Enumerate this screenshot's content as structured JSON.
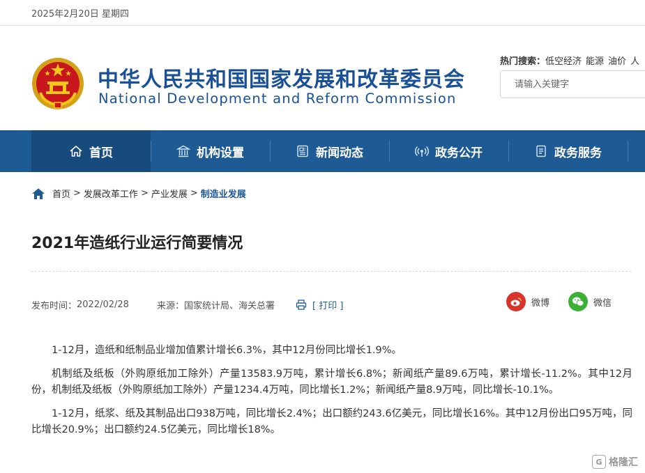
{
  "topbar": {
    "date": "2025年2月20日 星期四"
  },
  "header": {
    "site_name_cn": "中华人民共和国国家发展和改革委员会",
    "site_name_en": "National Development and Reform Commission",
    "hot_search_label": "热门搜索：",
    "hot_keywords": [
      "低空经济",
      "能源",
      "油价",
      "人"
    ],
    "search_placeholder": "请输入关键字"
  },
  "nav": {
    "items": [
      {
        "label": "首页",
        "icon": "home-icon",
        "active": true
      },
      {
        "label": "机构设置",
        "icon": "building-icon"
      },
      {
        "label": "新闻动态",
        "icon": "newspaper-icon"
      },
      {
        "label": "政务公开",
        "icon": "broadcast-icon"
      },
      {
        "label": "政务服务",
        "icon": "document-icon"
      }
    ]
  },
  "breadcrumb": {
    "items": [
      "首页",
      "发展改革工作",
      "产业发展"
    ],
    "current": "制造业发展",
    "separator": ">"
  },
  "article": {
    "title": "2021年造纸行业运行简要情况",
    "publish_label": "发布时间：",
    "publish_date": "2022/02/28",
    "source_label": "来源：",
    "source": "国家统计局、海关总署",
    "print_label": "[ 打印 ]",
    "paragraphs": [
      "1-12月，造纸和纸制品业增加值累计增长6.3%，其中12月份同比增长1.9%。",
      "机制纸及纸板（外购原纸加工除外）产量13583.9万吨，累计增长6.8%；新闻纸产量89.6万吨，累计增长-11.2%。其中12月份，机制纸及纸板（外购原纸加工除外）产量1234.4万吨，同比增长1.2%；新闻纸产量8.9万吨，同比增长-10.1%。",
      "1-12月，纸浆、纸及其制品出口938万吨，同比增长2.4%；出口额约243.6亿美元，同比增长16%。其中12月份出口95万吨，同比增长20.9%；出口额约24.5亿美元，同比增长18%。"
    ]
  },
  "share": {
    "weibo_label": "微博",
    "wechat_label": "微信"
  },
  "watermark": {
    "text": "格隆汇",
    "mark": "G"
  },
  "colors": {
    "brand_blue": "#1e5a94",
    "nav_active": "#174a7d",
    "weibo_red": "#d9342b",
    "wechat_green": "#3cb034"
  }
}
